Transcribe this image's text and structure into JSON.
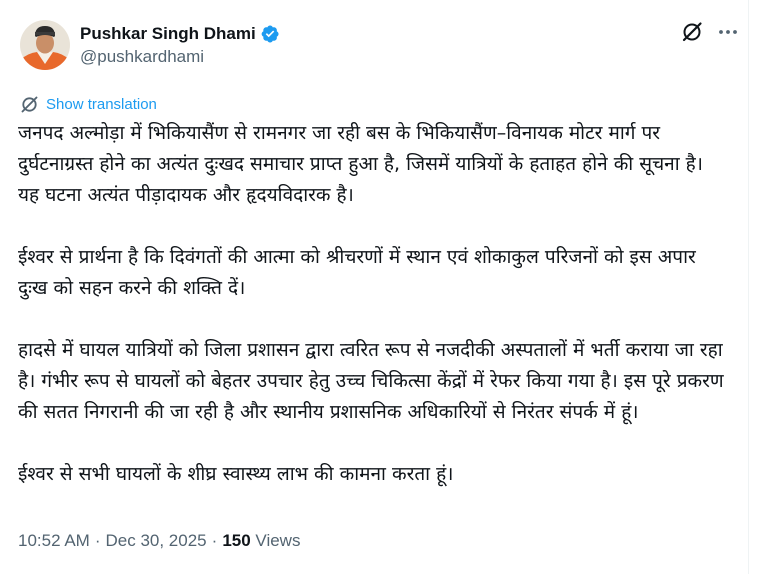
{
  "tweet": {
    "author": {
      "display_name": "Pushkar Singh Dhami",
      "handle": "@pushkardhami",
      "verified": true,
      "avatar_icon": "profile-photo"
    },
    "header_actions": {
      "grok_icon": "grok-icon",
      "more_icon": "more-horizontal-icon"
    },
    "show_translation_label": "Show translation",
    "paragraphs": [
      "जनपद अल्मोड़ा में भिकियासैंण से रामनगर जा रही बस के भिकियासैंण–विनायक मोटर मार्ग पर दुर्घटनाग्रस्त होने का अत्यंत दुःखद समाचार प्राप्त हुआ है, जिसमें यात्रियों के हताहत होने की सूचना है। यह घटना अत्यंत पीड़ादायक और हृदयविदारक है।",
      "ईश्वर से प्रार्थना है कि दिवंगतों की आत्मा को श्रीचरणों में स्थान एवं शोकाकुल परिजनों को इस अपार दुःख को सहन करने की शक्ति दें।",
      "हादसे में घायल यात्रियों को जिला प्रशासन द्वारा त्वरित रूप से नजदीकी अस्पतालों में भर्ती कराया जा रहा है। गंभीर रूप से घायलों को बेहतर उपचार हेतु उच्च चिकित्सा केंद्रों में रेफर किया गया है। इस पूरे प्रकरण की सतत निगरानी की जा रही है और स्थानीय प्रशासनिक अधिकारियों से निरंतर संपर्क में हूं।",
      "ईश्वर से सभी घायलों के शीघ्र स्वास्थ्य लाभ की कामना करता हूं।"
    ],
    "time": "10:52 AM",
    "separator": "·",
    "date": "Dec 30, 2025",
    "views_count": "150",
    "views_label": "Views",
    "colors": {
      "link": "#1d9bf0",
      "secondary_text": "#536471",
      "primary_text": "#0f1419",
      "verified_badge": "#1d9bf0"
    }
  }
}
